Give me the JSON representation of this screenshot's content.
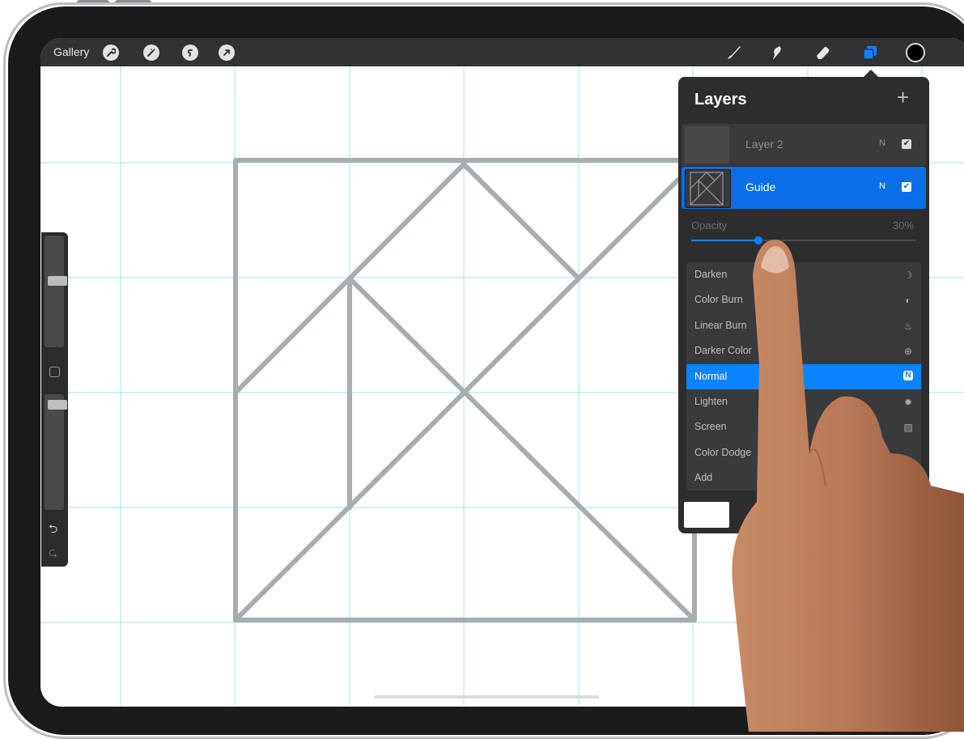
{
  "topbar": {
    "gallery_label": "Gallery",
    "left_tools": [
      "wrench-icon",
      "magic-wand-icon",
      "selection-icon",
      "transform-arrow-icon"
    ],
    "right_tools": [
      "brush-icon",
      "smudge-icon",
      "eraser-icon",
      "layers-icon"
    ],
    "current_color": "#000000"
  },
  "layers_panel": {
    "title": "Layers",
    "add_button": "+",
    "layers": [
      {
        "name": "Layer 2",
        "blend": "N",
        "visible": true,
        "selected": false
      },
      {
        "name": "Guide",
        "blend": "N",
        "visible": true,
        "selected": true
      }
    ],
    "opacity": {
      "label": "Opacity",
      "value_text": "30%",
      "value": 0.3
    },
    "blend_modes": [
      {
        "label": "Darken",
        "icon": "moon-icon",
        "glyph": "☽"
      },
      {
        "label": "Color Burn",
        "icon": "burn-icon",
        "glyph": "◐"
      },
      {
        "label": "Linear Burn",
        "icon": "flame-icon",
        "glyph": "♨"
      },
      {
        "label": "Darker Color",
        "icon": "plus-circle-icon",
        "glyph": "⊕"
      },
      {
        "label": "Normal",
        "icon": "normal-badge-icon",
        "glyph": "N",
        "selected": true
      },
      {
        "label": "Lighten",
        "icon": "sun-icon",
        "glyph": "✹"
      },
      {
        "label": "Screen",
        "icon": "hatch-icon",
        "glyph": "▨"
      },
      {
        "label": "Color Dodge",
        "icon": "",
        "glyph": ""
      },
      {
        "label": "Add",
        "icon": "",
        "glyph": ""
      }
    ]
  },
  "sidebar": {
    "size_level": 0.6,
    "opacity_level": 0.95,
    "undo_glyph": "⮌",
    "redo_glyph": "⮎"
  },
  "colors": {
    "accent": "#0a84ff",
    "selected_layer": "#0a6ee8",
    "guide_lines": "#a8adb0",
    "grid": "#a6e3ec"
  }
}
